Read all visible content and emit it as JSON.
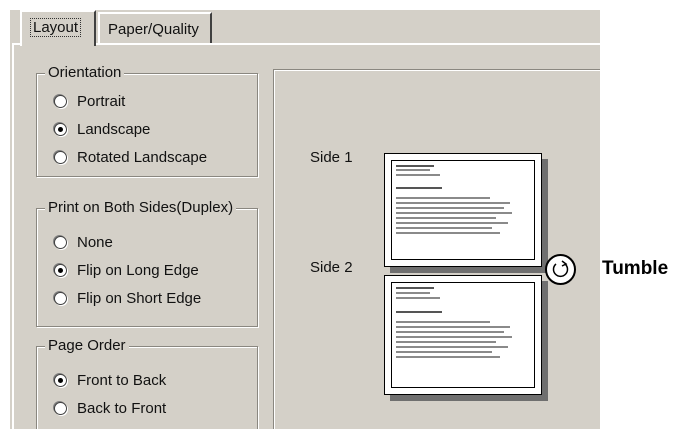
{
  "tabs": [
    {
      "label": "Layout",
      "active": true
    },
    {
      "label": "Paper/Quality",
      "active": false
    }
  ],
  "orientation": {
    "title": "Orientation",
    "options": [
      {
        "label": "Portrait",
        "checked": false
      },
      {
        "label": "Landscape",
        "checked": true
      },
      {
        "label": "Rotated Landscape",
        "checked": false
      }
    ]
  },
  "duplex": {
    "title": "Print on Both Sides(Duplex)",
    "options": [
      {
        "label": "None",
        "checked": false
      },
      {
        "label": "Flip on Long Edge",
        "checked": true
      },
      {
        "label": "Flip on Short Edge",
        "checked": false
      }
    ]
  },
  "page_order": {
    "title": "Page Order",
    "options": [
      {
        "label": "Front to Back",
        "checked": true
      },
      {
        "label": "Back to Front",
        "checked": false
      }
    ]
  },
  "preview": {
    "side1_label": "Side 1",
    "side2_label": "Side 2"
  },
  "callout": {
    "label": "Tumble",
    "icon": "rotate-arrow-icon"
  },
  "colors": {
    "dialog_bg": "#d4d0c8",
    "shadow": "#6f6f6f"
  }
}
